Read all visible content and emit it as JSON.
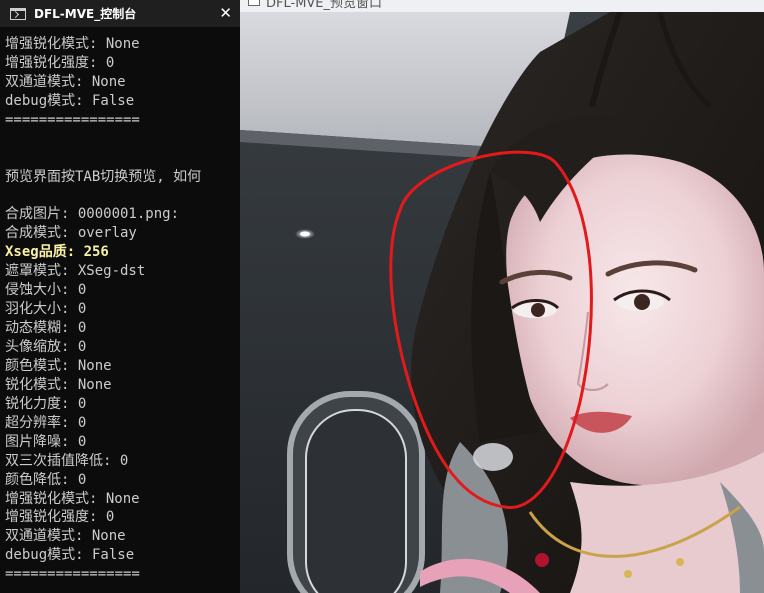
{
  "console": {
    "title": "DFL-MVE_控制台",
    "close_glyph": "✕",
    "lines": [
      {
        "text": "增强锐化模式: None",
        "hl": false
      },
      {
        "text": "增强锐化强度: 0",
        "hl": false
      },
      {
        "text": "双通道模式: None",
        "hl": false
      },
      {
        "text": "debug模式: False",
        "hl": false
      },
      {
        "text": "================",
        "hl": false
      },
      {
        "text": "",
        "hl": false
      },
      {
        "text": "",
        "hl": false
      },
      {
        "text": "预览界面按TAB切换预览, 如何",
        "hl": false
      },
      {
        "text": "",
        "hl": false
      },
      {
        "text": "合成图片: 0000001.png:",
        "hl": false
      },
      {
        "text": "合成模式: overlay",
        "hl": false
      },
      {
        "text": "Xseg品质: 256",
        "hl": true
      },
      {
        "text": "遮罩模式: XSeg-dst",
        "hl": false
      },
      {
        "text": "侵蚀大小: 0",
        "hl": false
      },
      {
        "text": "羽化大小: 0",
        "hl": false
      },
      {
        "text": "动态模糊: 0",
        "hl": false
      },
      {
        "text": "头像缩放: 0",
        "hl": false
      },
      {
        "text": "颜色模式: None",
        "hl": false
      },
      {
        "text": "锐化模式: None",
        "hl": false
      },
      {
        "text": "锐化力度: 0",
        "hl": false
      },
      {
        "text": "超分辨率: 0",
        "hl": false
      },
      {
        "text": "图片降噪: 0",
        "hl": false
      },
      {
        "text": "双三次插值降低: 0",
        "hl": false
      },
      {
        "text": "颜色降低: 0",
        "hl": false
      },
      {
        "text": "增强锐化模式: None",
        "hl": false
      },
      {
        "text": "增强锐化强度: 0",
        "hl": false
      },
      {
        "text": "双通道模式: None",
        "hl": false
      },
      {
        "text": "debug模式: False",
        "hl": false
      },
      {
        "text": "================",
        "hl": false
      }
    ]
  },
  "preview": {
    "title": "DFL-MVE_预览窗口",
    "annotation_color": "#e31a1c"
  }
}
